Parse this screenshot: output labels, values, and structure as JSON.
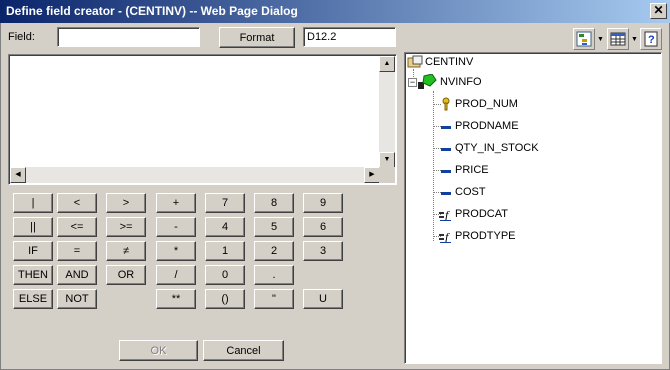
{
  "window": {
    "title": "Define field creator - (CENTINV) -- Web Page Dialog"
  },
  "field": {
    "label": "Field:",
    "value": ""
  },
  "format": {
    "button_label": "Format",
    "value": "D12.2"
  },
  "keypad": [
    [
      "|",
      "<",
      ">",
      "+",
      "7",
      "8",
      "9"
    ],
    [
      "||",
      "<=",
      ">=",
      "-",
      "4",
      "5",
      "6"
    ],
    [
      "IF",
      "=",
      "≠",
      "*",
      "1",
      "2",
      "3"
    ],
    [
      "THEN",
      "AND",
      "OR",
      "/",
      "0",
      "."
    ],
    [
      "ELSE",
      "NOT",
      "**",
      "()",
      "\"",
      "U"
    ]
  ],
  "actions": {
    "ok_label": "OK",
    "cancel_label": "Cancel"
  },
  "tree": {
    "root": "CENTINV",
    "child": "NVINFO",
    "fields": [
      {
        "name": "PROD_NUM",
        "icon": "key-icon"
      },
      {
        "name": "PRODNAME",
        "icon": "field-icon"
      },
      {
        "name": "QTY_IN_STOCK",
        "icon": "field-icon"
      },
      {
        "name": "PRICE",
        "icon": "field-icon"
      },
      {
        "name": "COST",
        "icon": "field-icon"
      },
      {
        "name": "PRODCAT",
        "icon": "function-field-icon"
      },
      {
        "name": "PRODTYPE",
        "icon": "function-field-icon"
      }
    ]
  },
  "toolbar": {
    "icons": [
      "tree-view-icon",
      "table-view-icon",
      "help-icon"
    ]
  }
}
